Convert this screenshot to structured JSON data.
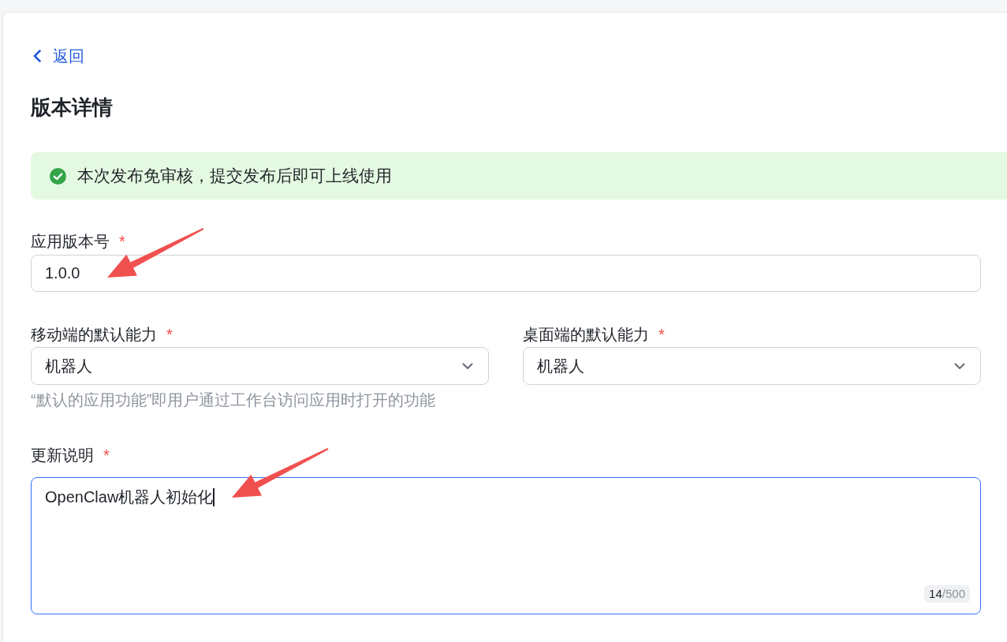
{
  "back_link": {
    "label": "返回"
  },
  "title": "版本详情",
  "alert": {
    "kind": "success",
    "text": "本次发布免审核，提交发布后即可上线使用"
  },
  "fields": [
    {
      "kind": "input",
      "label": "应用版本号",
      "required_mark": "*",
      "value": "1.0.0",
      "focused": false,
      "annotated": true
    },
    {
      "kind": "select_row",
      "items": [
        {
          "label": "移动端的默认能力",
          "required_mark": "*",
          "value": "机器人",
          "focused": false,
          "help": "“默认的应用功能”即用户通过工作台访问应用时打开的功能"
        },
        {
          "label": "桌面端的默认能力",
          "required_mark": "*",
          "value": "机器人",
          "focused": false
        }
      ]
    },
    {
      "kind": "textarea",
      "label": "更新说明",
      "required_mark": "*",
      "value": "OpenClaw机器人初始化",
      "focused": true,
      "counter": "**14**/500",
      "annotated": true
    }
  ]
}
